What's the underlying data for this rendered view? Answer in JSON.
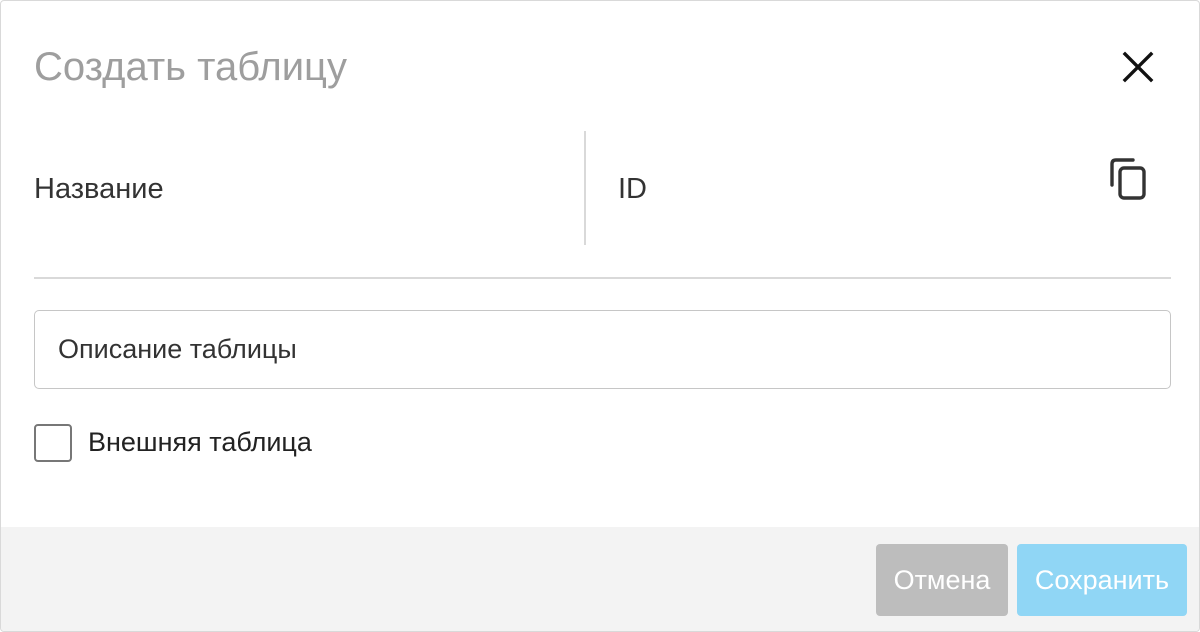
{
  "dialog": {
    "title": "Создать таблицу",
    "close_icon": "close-icon"
  },
  "fields": {
    "name_label": "Название",
    "id_label": "ID",
    "copy_icon": "copy-icon"
  },
  "description": {
    "value": "Описание таблицы"
  },
  "external": {
    "label": "Внешняя таблица",
    "checked": false
  },
  "footer": {
    "cancel_label": "Отмена",
    "save_label": "Сохранить"
  },
  "colors": {
    "title": "#9e9e9e",
    "cancel_bg": "#bdbdbd",
    "save_bg": "#90d6f5",
    "footer_bg": "#f3f3f3"
  }
}
